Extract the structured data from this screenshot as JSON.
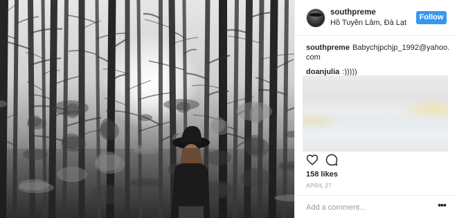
{
  "post": {
    "photo_description_icon": "forest-photo",
    "header": {
      "username": "southpreme",
      "location": "Hồ Tuyền Lâm, Đà Lạt",
      "follow_label": "Follow"
    },
    "comments": [
      {
        "user": "southpreme",
        "text": "Babychjpchjp_1992@yahoo.com"
      },
      {
        "user": "doanjulia",
        "text": ":)))))"
      }
    ],
    "actions": {
      "like_icon": "heart-icon",
      "comment_icon": "comment-icon"
    },
    "likes": "158 likes",
    "date": "APRIL 27",
    "add_comment": {
      "placeholder": "Add a comment...",
      "more_icon": "more-options-icon"
    }
  },
  "colors": {
    "accent": "#3897f0",
    "text": "#262626",
    "muted": "#999999",
    "border": "#efefef"
  }
}
